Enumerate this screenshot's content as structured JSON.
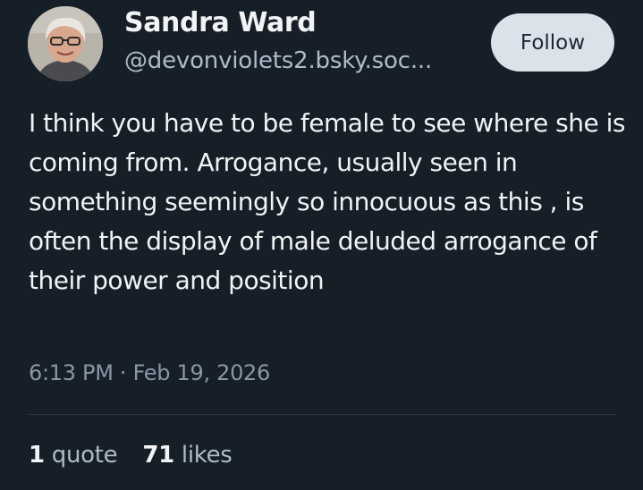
{
  "author": {
    "display_name": "Sandra Ward",
    "handle": "@devonviolets2.bsky.soc..."
  },
  "follow_button": {
    "label": "Follow"
  },
  "post": {
    "text": "I think you have to be female to see where she is coming from. Arrogance, usually seen in something seemingly so innocuous as this , is often the display of male deluded arrogance of their power and position",
    "timestamp": "6:13 PM · Feb 19, 2026"
  },
  "stats": {
    "quotes_count": "1",
    "quotes_label": "quote",
    "likes_count": "71",
    "likes_label": "likes"
  },
  "colors": {
    "background": "#161e27",
    "text_primary": "#f1f3f5",
    "text_secondary": "#aebbc9",
    "follow_button_bg": "#dce2ea"
  }
}
